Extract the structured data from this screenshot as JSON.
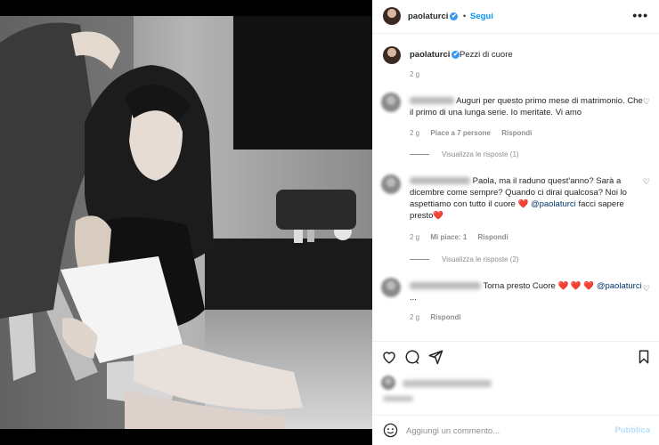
{
  "header": {
    "username": "paolaturci",
    "verified_mark": "✔",
    "separator": "•",
    "follow_label": "Segui",
    "more_label": "•••"
  },
  "caption": {
    "username": "paolaturci",
    "text": "Pezzi di cuore",
    "time": "2 g"
  },
  "comments": [
    {
      "text": "Auguri per questo primo mese di matrimonio. Che il primo di una lunga serie. Io meritate. Vi amo",
      "time": "2 g",
      "likes": "Piace a 7 persone",
      "reply_label": "Rispondi",
      "view_replies": "Visualizza le risposte (1)"
    },
    {
      "text_before": "Paola, ma il raduno quest'anno? Sarà a dicembre come sempre? Quando ci dirai qualcosa? Noi lo aspettiamo con tutto il cuore",
      "heart": "❤️",
      "mention": "@paolaturci",
      "text_after": "facci sapere presto",
      "time": "2 g",
      "likes": "Mi piace: 1",
      "reply_label": "Rispondi",
      "view_replies": "Visualizza le risposte (2)"
    },
    {
      "text": "Torna presto Cuore",
      "hearts": "❤️ ❤️ ❤️",
      "mention": "@paolaturci",
      "trail": "...",
      "time": "2 g",
      "reply_label": "Rispondi"
    }
  ],
  "add_comment": {
    "placeholder": "Aggiungi un commento...",
    "publish_label": "Pubblica"
  },
  "icons": [
    "heart-icon",
    "comment-icon",
    "share-icon",
    "bookmark-icon",
    "emoji-icon",
    "more-icon",
    "verified-icon"
  ],
  "colors": {
    "accent": "#0095f6",
    "publish_disabled": "#b2dffc",
    "verified": "#3897f0",
    "heart": "#ed4956",
    "muted": "#8e8e8e"
  }
}
